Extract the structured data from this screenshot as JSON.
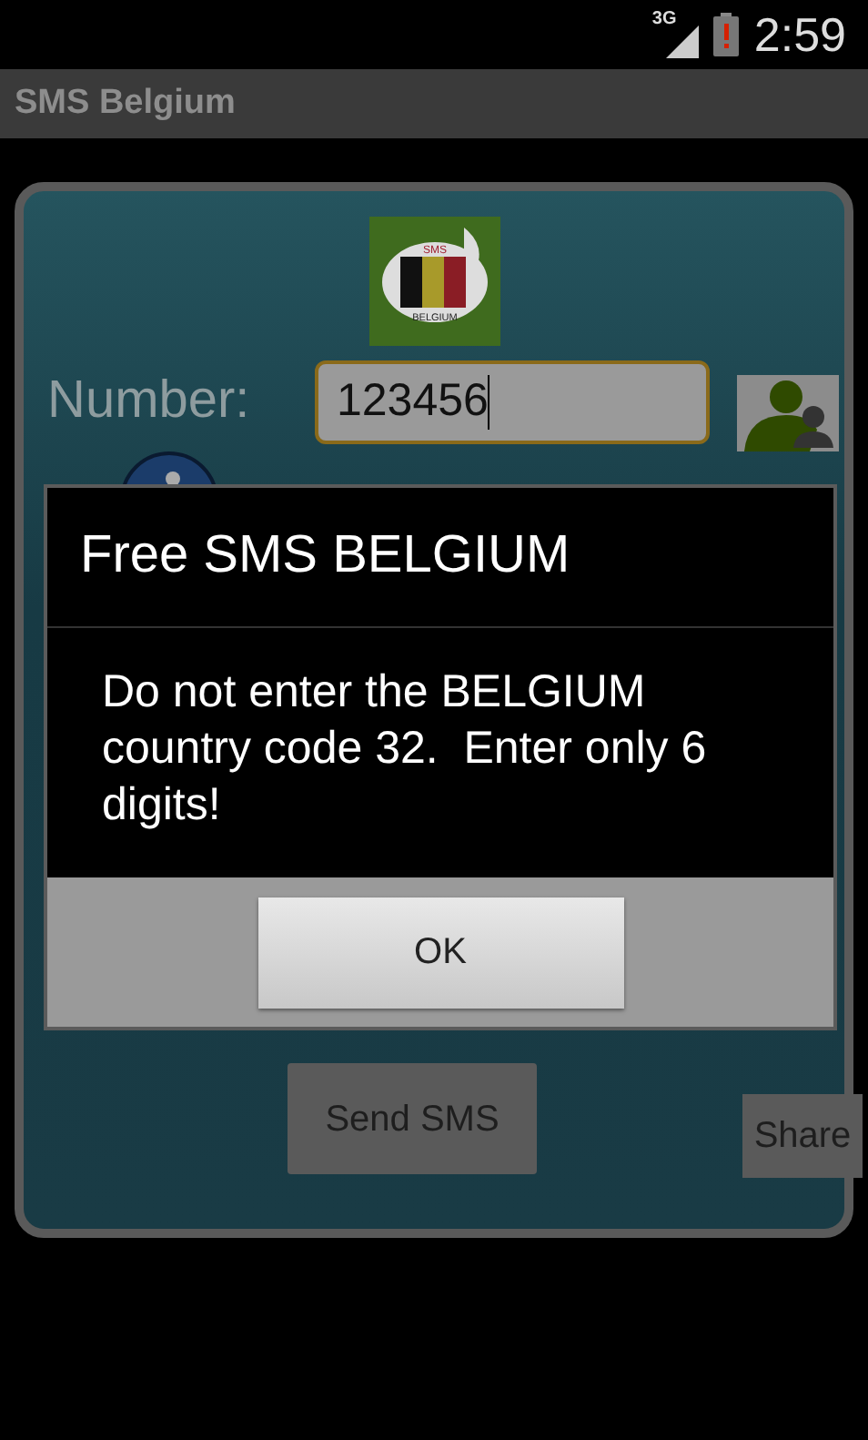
{
  "status_bar": {
    "network": "3G",
    "battery_alert": true,
    "time": "2:59"
  },
  "app_bar": {
    "title": "SMS Belgium"
  },
  "form": {
    "logo": {
      "top": "SMS",
      "bottom": "BELGIUM"
    },
    "number_label": "Number:",
    "number_value": "123456",
    "focused": true,
    "send_button": "Send SMS",
    "share_button": "Share"
  },
  "dialog": {
    "title": "Free SMS BELGIUM",
    "message": "Do not enter the BELGIUM country code 32.  Enter only 6 digits!",
    "buttons": [
      "OK"
    ]
  }
}
